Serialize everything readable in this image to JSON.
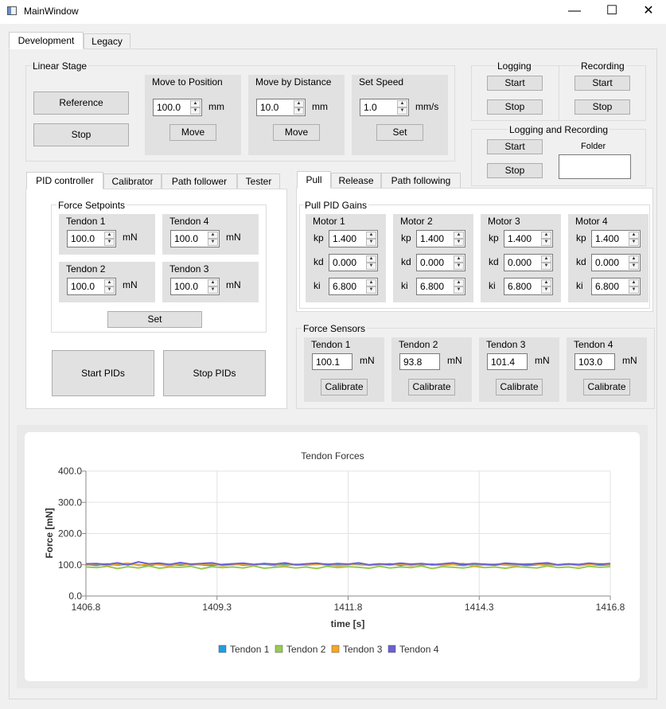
{
  "window": {
    "title": "MainWindow",
    "minimize": "—",
    "maximize": "☐",
    "close": "✕"
  },
  "main_tabs": [
    "Development",
    "Legacy"
  ],
  "linear_stage": {
    "title": "Linear Stage",
    "reference": "Reference",
    "stop": "Stop",
    "move_to_position": {
      "title": "Move to Position",
      "value": "100.0",
      "unit": "mm",
      "button": "Move"
    },
    "move_by_distance": {
      "title": "Move by Distance",
      "value": "10.0",
      "unit": "mm",
      "button": "Move"
    },
    "set_speed": {
      "title": "Set Speed",
      "value": "1.0",
      "unit": "mm/s",
      "button": "Set"
    }
  },
  "logging": {
    "title": "Logging",
    "start": "Start",
    "stop": "Stop"
  },
  "recording": {
    "title": "Recording",
    "start": "Start",
    "stop": "Stop"
  },
  "logging_recording": {
    "title": "Logging and Recording",
    "start": "Start",
    "stop": "Stop",
    "folder_label": "Folder",
    "folder_value": ""
  },
  "left_tabs": [
    "PID controller",
    "Calibrator",
    "Path follower",
    "Tester"
  ],
  "force_setpoints": {
    "title": "Force Setpoints",
    "unit": "mN",
    "tendons": [
      {
        "label": "Tendon 1",
        "value": "100.0"
      },
      {
        "label": "Tendon 4",
        "value": "100.0"
      },
      {
        "label": "Tendon 2",
        "value": "100.0"
      },
      {
        "label": "Tendon 3",
        "value": "100.0"
      }
    ],
    "set_button": "Set"
  },
  "start_pids": "Start PIDs",
  "stop_pids": "Stop PIDs",
  "right_tabs": [
    "Pull",
    "Release",
    "Path following"
  ],
  "pull_pid_gains": {
    "title": "Pull PID Gains",
    "gain_labels": [
      "kp",
      "kd",
      "ki"
    ],
    "motors": [
      {
        "label": "Motor 1",
        "kp": "1.400",
        "kd": "0.000",
        "ki": "6.800"
      },
      {
        "label": "Motor 2",
        "kp": "1.400",
        "kd": "0.000",
        "ki": "6.800"
      },
      {
        "label": "Motor 3",
        "kp": "1.400",
        "kd": "0.000",
        "ki": "6.800"
      },
      {
        "label": "Motor 4",
        "kp": "1.400",
        "kd": "0.000",
        "ki": "6.800"
      }
    ]
  },
  "force_sensors": {
    "title": "Force Sensors",
    "unit": "mN",
    "button": "Calibrate",
    "sensors": [
      {
        "label": "Tendon 1",
        "value": "100.1"
      },
      {
        "label": "Tendon 2",
        "value": "93.8"
      },
      {
        "label": "Tendon 3",
        "value": "101.4"
      },
      {
        "label": "Tendon 4",
        "value": "103.0"
      }
    ]
  },
  "chart_data": {
    "type": "line",
    "title": "Tendon Forces",
    "xlabel": "time [s]",
    "ylabel": "Force [mN]",
    "xlim": [
      1406.8,
      1416.8
    ],
    "ylim": [
      0,
      400
    ],
    "x_ticks": [
      "1406.8",
      "1409.3",
      "1411.8",
      "1414.3",
      "1416.8"
    ],
    "y_ticks": [
      "0.0",
      "100.0",
      "200.0",
      "300.0",
      "400.0"
    ],
    "grid": true,
    "legend_position": "bottom",
    "series": [
      {
        "name": "Tendon 1",
        "color": "#209fdf",
        "x": [
          1406.8,
          1407.0,
          1407.2,
          1407.4,
          1407.6,
          1407.8,
          1408.0,
          1408.2,
          1408.4,
          1408.6,
          1408.8,
          1409.0,
          1409.2,
          1409.4,
          1409.6,
          1409.8,
          1410.0,
          1410.2,
          1410.4,
          1410.6,
          1410.8,
          1411.0,
          1411.2,
          1411.4,
          1411.6,
          1411.8,
          1412.0,
          1412.2,
          1412.4,
          1412.6,
          1412.8,
          1413.0,
          1413.2,
          1413.4,
          1413.6,
          1413.8,
          1414.0,
          1414.2,
          1414.4,
          1414.6,
          1414.8,
          1415.0,
          1415.2,
          1415.4,
          1415.6,
          1415.8,
          1416.0,
          1416.2,
          1416.4,
          1416.6,
          1416.8
        ],
        "values": [
          101,
          98,
          103,
          99,
          102,
          100,
          97,
          103,
          101,
          99,
          102,
          100,
          98,
          101,
          103,
          99,
          100,
          102,
          98,
          101,
          100,
          99,
          103,
          100,
          98,
          102,
          101,
          99,
          100,
          103,
          98,
          101,
          100,
          102,
          99,
          101,
          98,
          103,
          100,
          99,
          102,
          101,
          98,
          100,
          103,
          99,
          101,
          100,
          102,
          99,
          100
        ]
      },
      {
        "name": "Tendon 2",
        "color": "#99ca53",
        "x": [
          1406.8,
          1407.0,
          1407.2,
          1407.4,
          1407.6,
          1407.8,
          1408.0,
          1408.2,
          1408.4,
          1408.6,
          1408.8,
          1409.0,
          1409.2,
          1409.4,
          1409.6,
          1409.8,
          1410.0,
          1410.2,
          1410.4,
          1410.6,
          1410.8,
          1411.0,
          1411.2,
          1411.4,
          1411.6,
          1411.8,
          1412.0,
          1412.2,
          1412.4,
          1412.6,
          1412.8,
          1413.0,
          1413.2,
          1413.4,
          1413.6,
          1413.8,
          1414.0,
          1414.2,
          1414.4,
          1414.6,
          1414.8,
          1415.0,
          1415.2,
          1415.4,
          1415.6,
          1415.8,
          1416.0,
          1416.2,
          1416.4,
          1416.6,
          1416.8
        ],
        "values": [
          93,
          91,
          95,
          88,
          94,
          90,
          96,
          89,
          93,
          92,
          95,
          87,
          94,
          91,
          93,
          90,
          96,
          89,
          92,
          94,
          90,
          93,
          88,
          95,
          91,
          94,
          92,
          89,
          95,
          90,
          93,
          91,
          96,
          88,
          94,
          92,
          90,
          95,
          91,
          93,
          89,
          94,
          92,
          90,
          96,
          91,
          93,
          89,
          95,
          92,
          94
        ]
      },
      {
        "name": "Tendon 3",
        "color": "#f6a625",
        "x": [
          1406.8,
          1407.0,
          1407.2,
          1407.4,
          1407.6,
          1407.8,
          1408.0,
          1408.2,
          1408.4,
          1408.6,
          1408.8,
          1409.0,
          1409.2,
          1409.4,
          1409.6,
          1409.8,
          1410.0,
          1410.2,
          1410.4,
          1410.6,
          1410.8,
          1411.0,
          1411.2,
          1411.4,
          1411.6,
          1411.8,
          1412.0,
          1412.2,
          1412.4,
          1412.6,
          1412.8,
          1413.0,
          1413.2,
          1413.4,
          1413.6,
          1413.8,
          1414.0,
          1414.2,
          1414.4,
          1414.6,
          1414.8,
          1415.0,
          1415.2,
          1415.4,
          1415.6,
          1415.8,
          1416.0,
          1416.2,
          1416.4,
          1416.6,
          1416.8
        ],
        "values": [
          99,
          103,
          97,
          101,
          105,
          98,
          102,
          100,
          96,
          104,
          99,
          101,
          103,
          97,
          100,
          102,
          98,
          104,
          100,
          97,
          102,
          99,
          101,
          103,
          96,
          100,
          104,
          98,
          101,
          99,
          102,
          97,
          103,
          100,
          98,
          101,
          104,
          96,
          100,
          102,
          99,
          97,
          103,
          101,
          98,
          100,
          102,
          97,
          101,
          103,
          100
        ]
      },
      {
        "name": "Tendon 4",
        "color": "#6d5fd5",
        "x": [
          1406.8,
          1407.0,
          1407.2,
          1407.4,
          1407.6,
          1407.8,
          1408.0,
          1408.2,
          1408.4,
          1408.6,
          1408.8,
          1409.0,
          1409.2,
          1409.4,
          1409.6,
          1409.8,
          1410.0,
          1410.2,
          1410.4,
          1410.6,
          1410.8,
          1411.0,
          1411.2,
          1411.4,
          1411.6,
          1411.8,
          1412.0,
          1412.2,
          1412.4,
          1412.6,
          1412.8,
          1413.0,
          1413.2,
          1413.4,
          1413.6,
          1413.8,
          1414.0,
          1414.2,
          1414.4,
          1414.6,
          1414.8,
          1415.0,
          1415.2,
          1415.4,
          1415.6,
          1415.8,
          1416.0,
          1416.2,
          1416.4,
          1416.6,
          1416.8
        ],
        "values": [
          103,
          104,
          101,
          106,
          100,
          109,
          103,
          105,
          101,
          107,
          102,
          104,
          106,
          100,
          103,
          105,
          101,
          104,
          102,
          106,
          100,
          103,
          105,
          101,
          104,
          102,
          106,
          100,
          103,
          101,
          105,
          102,
          104,
          100,
          103,
          106,
          101,
          104,
          102,
          100,
          105,
          103,
          101,
          104,
          106,
          100,
          103,
          101,
          105,
          102,
          104
        ]
      }
    ]
  }
}
